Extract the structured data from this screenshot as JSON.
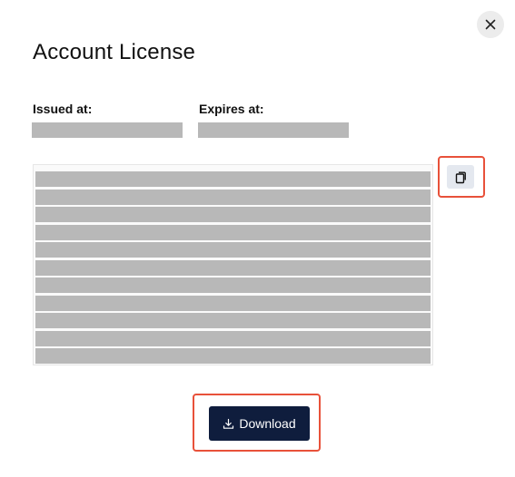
{
  "dialog": {
    "title": "Account License",
    "issued_label": "Issued at:",
    "expires_label": "Expires at:",
    "issued_value": "",
    "expires_value": "",
    "license_line_count": 11,
    "download_label": "Download",
    "close_icon": "close-icon",
    "copy_icon": "copy-icon",
    "download_icon": "download-icon"
  },
  "colors": {
    "primary_button": "#0f1d3d",
    "highlight": "#e8513a",
    "redaction": "#b8b8b8"
  }
}
